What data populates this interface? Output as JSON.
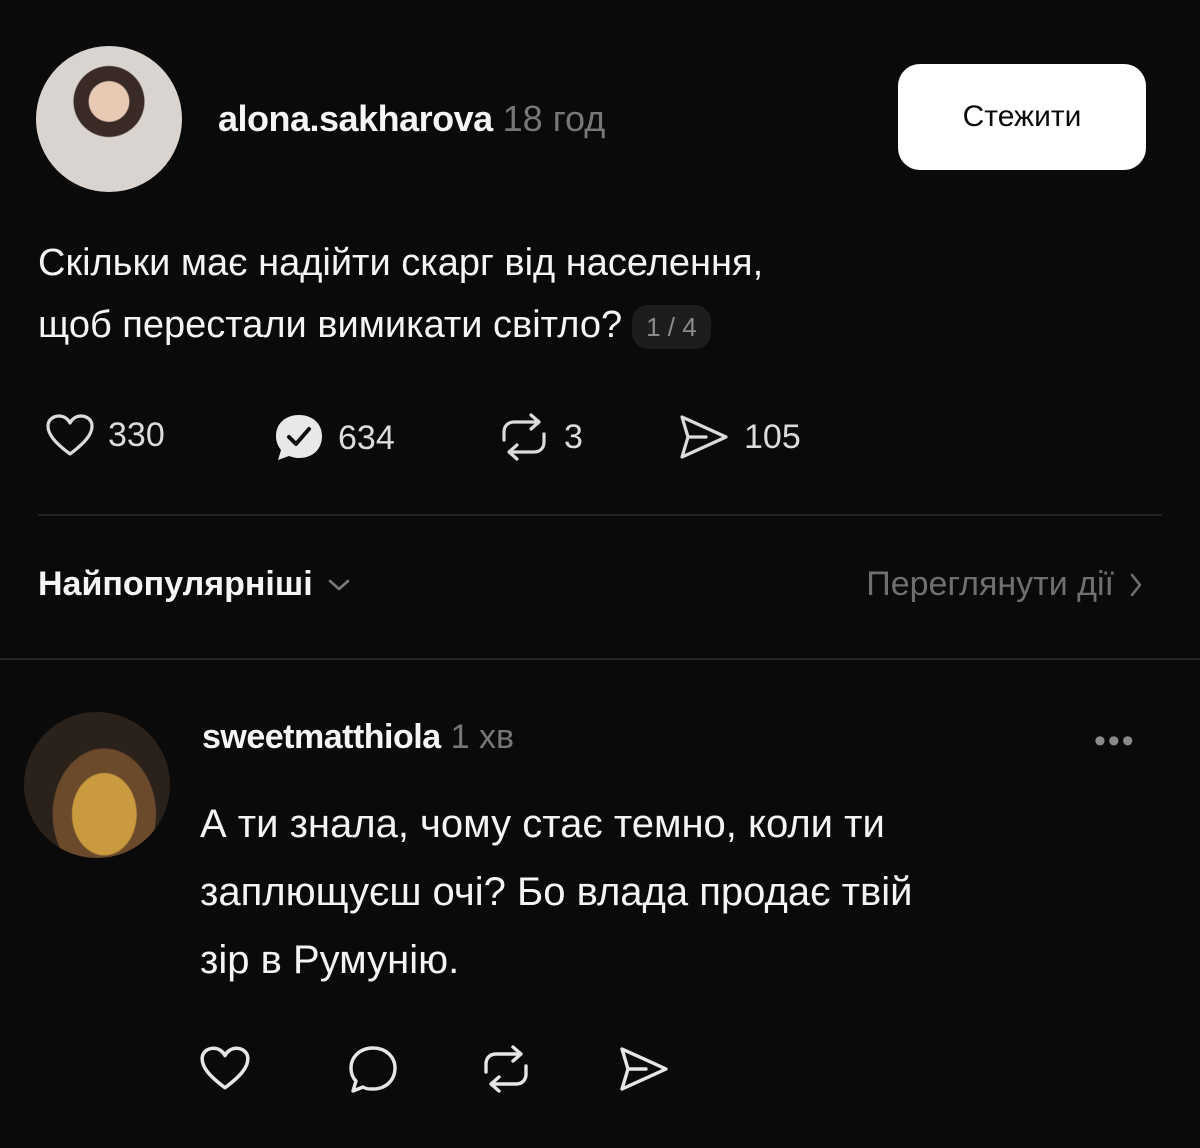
{
  "post": {
    "username": "alona.sakharova",
    "time": "18 год",
    "follow_label": "Стежити",
    "text_line1": "Скільки має надійти скарг від населення,",
    "text_line2": "щоб перестали вимикати світло?",
    "page_indicator": "1 / 4",
    "stats": {
      "likes": "330",
      "replies": "634",
      "reposts": "3",
      "shares": "105"
    }
  },
  "sort": {
    "label": "Найпопулярніші",
    "view_activity_label": "Переглянути дії"
  },
  "comment": {
    "username": "sweetmatthiola",
    "time": "1 хв",
    "more_label": "•••",
    "text_line1": "А ти знала, чому стає темно, коли ти",
    "text_line2": "заплющуєш очі? Бо влада продає твій",
    "text_line3": "зір в Румунію."
  },
  "icons": {
    "like": "heart-icon",
    "reply": "comment-bubble-icon",
    "repost": "repost-icon",
    "share": "send-icon",
    "sort_chevron": "chevron-down-icon",
    "activity_chevron": "chevron-right-icon"
  },
  "colors": {
    "background": "#0a0a0a",
    "follow_button": "#ffffff",
    "muted_text": "#777777"
  }
}
